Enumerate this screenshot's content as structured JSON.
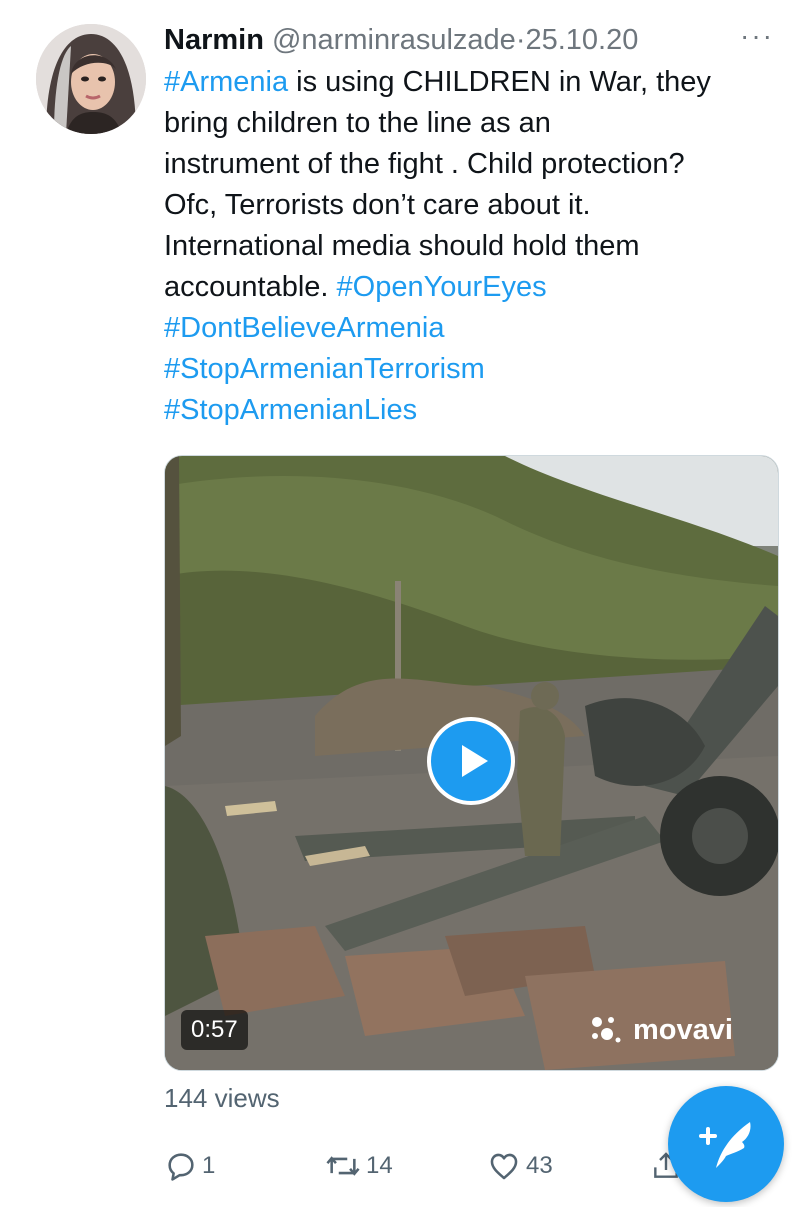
{
  "tweet": {
    "author_name": "Narmin",
    "handle": "@narminrasulzade",
    "separator": "·",
    "date": "25.10.20",
    "more_label": "···",
    "text_lines": [
      {
        "parts": [
          {
            "t": "#Armenia",
            "tag": true
          },
          {
            "t": " is using CHILDREN in War, they",
            "tag": false
          }
        ]
      },
      {
        "parts": [
          {
            "t": "bring children to the line as an",
            "tag": false
          }
        ]
      },
      {
        "parts": [
          {
            "t": "instrument of the fight . Child protection?",
            "tag": false
          }
        ]
      },
      {
        "parts": [
          {
            "t": "Ofc, Terrorists don’t care about it.",
            "tag": false
          }
        ]
      },
      {
        "parts": [
          {
            "t": "International media should hold them",
            "tag": false
          }
        ]
      },
      {
        "parts": [
          {
            "t": "accountable. ",
            "tag": false
          },
          {
            "t": "#OpenYourEyes",
            "tag": true
          }
        ]
      },
      {
        "parts": [
          {
            "t": "#DontBelieveArmenia",
            "tag": true
          }
        ]
      },
      {
        "parts": [
          {
            "t": "#StopArmenianTerrorism",
            "tag": true
          }
        ]
      },
      {
        "parts": [
          {
            "t": "#StopArmenianLies",
            "tag": true
          }
        ]
      }
    ],
    "media": {
      "duration": "0:57",
      "watermark": "movavi"
    },
    "views": "144 views",
    "actions": {
      "reply_count": "1",
      "retweet_count": "14",
      "like_count": "43"
    }
  },
  "colors": {
    "accent": "#1d9bf0",
    "text": "#0f1419",
    "secondary": "#536471"
  },
  "icons": [
    "reply-icon",
    "retweet-icon",
    "like-icon",
    "share-icon",
    "play-icon",
    "compose-icon",
    "more-icon"
  ]
}
